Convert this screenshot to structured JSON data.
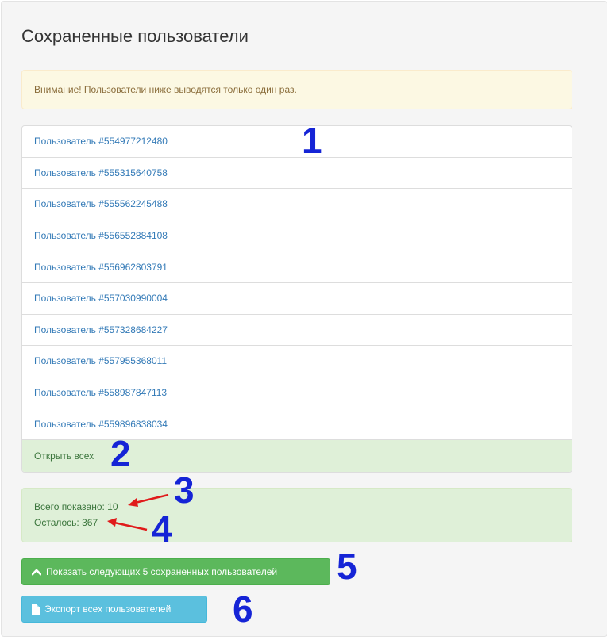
{
  "page": {
    "title": "Сохраненные пользователи"
  },
  "warning": {
    "text": "Внимание! Пользователи ниже выводятся только один раз."
  },
  "users": {
    "items": [
      "Пользователь #554977212480",
      "Пользователь #555315640758",
      "Пользователь #555562245488",
      "Пользователь #556552884108",
      "Пользователь #556962803791",
      "Пользователь #557030990004",
      "Пользователь #557328684227",
      "Пользователь #557955368011",
      "Пользователь #558987847113",
      "Пользователь #559896838034"
    ],
    "open_all_label": "Открыть всех"
  },
  "stats": {
    "shown_text": "Всего показано: 10",
    "remaining_text": "Осталось: 367"
  },
  "buttons": {
    "show_next_label": "Показать следующих 5 сохраненных пользователей",
    "export_label": "Экспорт всех пользователей"
  },
  "annotations": [
    "1",
    "2",
    "3",
    "4",
    "5",
    "6"
  ],
  "icons": {
    "show_next": "chevron-up-icon",
    "export": "file-icon"
  },
  "colors": {
    "link": "#337ab7",
    "success_bg": "#dff0d8",
    "success_text": "#3c763d",
    "warning_bg": "#fcf8e3",
    "warning_text": "#8a6d3b",
    "btn_success": "#5cb85c",
    "btn_info": "#5bc0de",
    "annotation": "#1524d6",
    "arrow": "#e01b1b"
  }
}
